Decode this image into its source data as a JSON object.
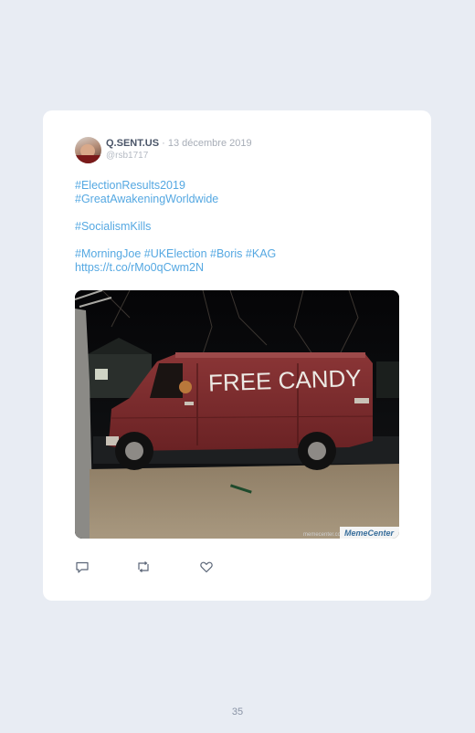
{
  "tweet": {
    "author": "Q.SENT.US",
    "separator": "·",
    "date": "13 décembre 2019",
    "handle": "@rsb1717",
    "lines": [
      "#ElectionResults2019",
      "#GreatAwakeningWorldwide",
      "",
      "#SocialismKills",
      "",
      "#MorningJoe #UKElection #Boris #KAG",
      "https://t.co/rMo0qCwm2N"
    ],
    "image": {
      "van_text": "FREE CANDY",
      "watermark": "memecenter.com",
      "watermark_logo": "MemeCenter"
    },
    "actions": [
      "reply-icon",
      "retweet-icon",
      "like-icon"
    ]
  },
  "page_number": "35",
  "colors": {
    "link": "#55a8e2",
    "background": "#e8ecf3",
    "card": "#ffffff",
    "van": "#7b2b2c"
  }
}
